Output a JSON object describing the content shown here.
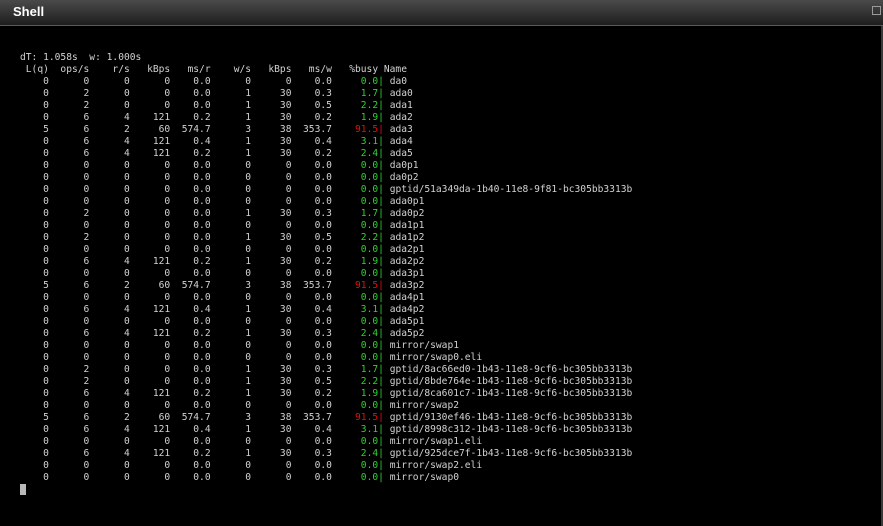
{
  "window": {
    "title": "Shell"
  },
  "colors": {
    "ok": "#2fd32f",
    "hot": "#e21010",
    "text": "#d2d2d2",
    "background": "#000000"
  },
  "gstat": {
    "summary": "dT: 1.058s  w: 1.000s",
    "header": " L(q)  ops/s    r/s   kBps   ms/r    w/s   kBps   ms/w   %busy Name",
    "rows": [
      {
        "pre": "    0      0      0      0    0.0      0      0    0.0",
        "busy": "0.0",
        "level": "g",
        "name": "da0"
      },
      {
        "pre": "    0      2      0      0    0.0      1     30    0.3",
        "busy": "1.7",
        "level": "g",
        "name": "ada0"
      },
      {
        "pre": "    0      2      0      0    0.0      1     30    0.5",
        "busy": "2.2",
        "level": "g",
        "name": "ada1"
      },
      {
        "pre": "    0      6      4    121    0.2      1     30    0.2",
        "busy": "1.9",
        "level": "g",
        "name": "ada2"
      },
      {
        "pre": "    5      6      2     60  574.7      3     38  353.7",
        "busy": "91.5",
        "level": "r",
        "name": "ada3"
      },
      {
        "pre": "    0      6      4    121    0.4      1     30    0.4",
        "busy": "3.1",
        "level": "g",
        "name": "ada4"
      },
      {
        "pre": "    0      6      4    121    0.2      1     30    0.2",
        "busy": "2.4",
        "level": "g",
        "name": "ada5"
      },
      {
        "pre": "    0      0      0      0    0.0      0      0    0.0",
        "busy": "0.0",
        "level": "g",
        "name": "da0p1"
      },
      {
        "pre": "    0      0      0      0    0.0      0      0    0.0",
        "busy": "0.0",
        "level": "g",
        "name": "da0p2"
      },
      {
        "pre": "    0      0      0      0    0.0      0      0    0.0",
        "busy": "0.0",
        "level": "g",
        "name": "gptid/51a349da-1b40-11e8-9f81-bc305bb3313b"
      },
      {
        "pre": "    0      0      0      0    0.0      0      0    0.0",
        "busy": "0.0",
        "level": "g",
        "name": "ada0p1"
      },
      {
        "pre": "    0      2      0      0    0.0      1     30    0.3",
        "busy": "1.7",
        "level": "g",
        "name": "ada0p2"
      },
      {
        "pre": "    0      0      0      0    0.0      0      0    0.0",
        "busy": "0.0",
        "level": "g",
        "name": "ada1p1"
      },
      {
        "pre": "    0      2      0      0    0.0      1     30    0.5",
        "busy": "2.2",
        "level": "g",
        "name": "ada1p2"
      },
      {
        "pre": "    0      0      0      0    0.0      0      0    0.0",
        "busy": "0.0",
        "level": "g",
        "name": "ada2p1"
      },
      {
        "pre": "    0      6      4    121    0.2      1     30    0.2",
        "busy": "1.9",
        "level": "g",
        "name": "ada2p2"
      },
      {
        "pre": "    0      0      0      0    0.0      0      0    0.0",
        "busy": "0.0",
        "level": "g",
        "name": "ada3p1"
      },
      {
        "pre": "    5      6      2     60  574.7      3     38  353.7",
        "busy": "91.5",
        "level": "r",
        "name": "ada3p2"
      },
      {
        "pre": "    0      0      0      0    0.0      0      0    0.0",
        "busy": "0.0",
        "level": "g",
        "name": "ada4p1"
      },
      {
        "pre": "    0      6      4    121    0.4      1     30    0.4",
        "busy": "3.1",
        "level": "g",
        "name": "ada4p2"
      },
      {
        "pre": "    0      0      0      0    0.0      0      0    0.0",
        "busy": "0.0",
        "level": "g",
        "name": "ada5p1"
      },
      {
        "pre": "    0      6      4    121    0.2      1     30    0.3",
        "busy": "2.4",
        "level": "g",
        "name": "ada5p2"
      },
      {
        "pre": "    0      0      0      0    0.0      0      0    0.0",
        "busy": "0.0",
        "level": "g",
        "name": "mirror/swap1"
      },
      {
        "pre": "    0      0      0      0    0.0      0      0    0.0",
        "busy": "0.0",
        "level": "g",
        "name": "mirror/swap0.eli"
      },
      {
        "pre": "    0      2      0      0    0.0      1     30    0.3",
        "busy": "1.7",
        "level": "g",
        "name": "gptid/8ac66ed0-1b43-11e8-9cf6-bc305bb3313b"
      },
      {
        "pre": "    0      2      0      0    0.0      1     30    0.5",
        "busy": "2.2",
        "level": "g",
        "name": "gptid/8bde764e-1b43-11e8-9cf6-bc305bb3313b"
      },
      {
        "pre": "    0      6      4    121    0.2      1     30    0.2",
        "busy": "1.9",
        "level": "g",
        "name": "gptid/8ca601c7-1b43-11e8-9cf6-bc305bb3313b"
      },
      {
        "pre": "    0      0      0      0    0.0      0      0    0.0",
        "busy": "0.0",
        "level": "g",
        "name": "mirror/swap2"
      },
      {
        "pre": "    5      6      2     60  574.7      3     38  353.7",
        "busy": "91.5",
        "level": "r",
        "name": "gptid/9130ef46-1b43-11e8-9cf6-bc305bb3313b"
      },
      {
        "pre": "    0      6      4    121    0.4      1     30    0.4",
        "busy": "3.1",
        "level": "g",
        "name": "gptid/8998c312-1b43-11e8-9cf6-bc305bb3313b"
      },
      {
        "pre": "    0      0      0      0    0.0      0      0    0.0",
        "busy": "0.0",
        "level": "g",
        "name": "mirror/swap1.eli"
      },
      {
        "pre": "    0      6      4    121    0.2      1     30    0.3",
        "busy": "2.4",
        "level": "g",
        "name": "gptid/925dce7f-1b43-11e8-9cf6-bc305bb3313b"
      },
      {
        "pre": "    0      0      0      0    0.0      0      0    0.0",
        "busy": "0.0",
        "level": "g",
        "name": "mirror/swap2.eli"
      },
      {
        "pre": "    0      0      0      0    0.0      0      0    0.0",
        "busy": "0.0",
        "level": "g",
        "name": "mirror/swap0"
      }
    ]
  },
  "icons": {
    "resize": "resize-icon",
    "cursor": "block-cursor"
  }
}
